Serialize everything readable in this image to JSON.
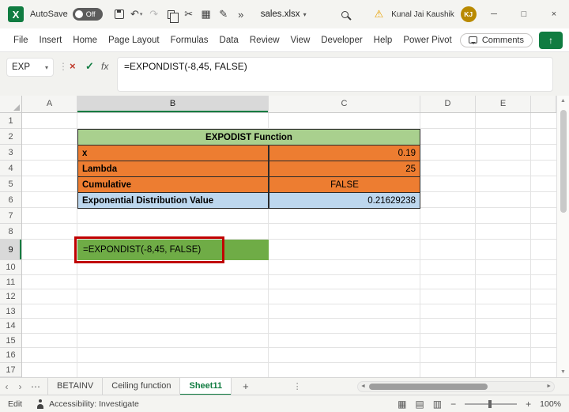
{
  "titlebar": {
    "app_logo": "X",
    "autosave_label": "AutoSave",
    "autosave_state": "Off",
    "more_commands": "»",
    "filename": "sales.xlsx",
    "user_name": "Kunal Jai Kaushik",
    "user_initials": "KJ"
  },
  "ribbon": {
    "tabs": [
      "File",
      "Insert",
      "Home",
      "Page Layout",
      "Formulas",
      "Data",
      "Review",
      "View",
      "Developer",
      "Help",
      "Power Pivot"
    ],
    "comments_label": "Comments"
  },
  "formula_bar": {
    "name_box_value": "EXP",
    "fx_label": "fx",
    "formula": "=EXPONDIST(-8,45, FALSE)"
  },
  "grid": {
    "column_labels": [
      "A",
      "B",
      "C",
      "D",
      "E"
    ],
    "row_labels": [
      "1",
      "2",
      "3",
      "4",
      "5",
      "6",
      "7",
      "8",
      "9",
      "10",
      "11",
      "12",
      "13",
      "14",
      "15",
      "16",
      "17"
    ],
    "selected_column": "B",
    "selected_row": "9"
  },
  "sheet": {
    "table": {
      "title": "EXPODIST Function",
      "rows": [
        {
          "label": "x",
          "value": "0.19"
        },
        {
          "label": "Lambda",
          "value": "25"
        },
        {
          "label": "Cumulative",
          "value": "FALSE"
        },
        {
          "label": "Exponential Distribution Value",
          "value": "0.21629238"
        }
      ]
    },
    "b9_formula": "=EXPONDIST(-8,45, FALSE)"
  },
  "sheet_tabs": {
    "tabs": [
      {
        "name": "BETAINV",
        "active": false
      },
      {
        "name": "Ceiling function",
        "active": false
      },
      {
        "name": "Sheet11",
        "active": true
      }
    ]
  },
  "status_bar": {
    "mode": "Edit",
    "accessibility": "Accessibility: Investigate",
    "zoom": "100%"
  },
  "colors": {
    "excel_green": "#107C41",
    "table_header_green": "#A9D08E",
    "orange": "#ED7D31",
    "light_blue": "#BDD7EE",
    "result_green": "#6FAC46",
    "highlight_red": "#C00000",
    "avatar_gold": "#B98A00",
    "warning_yellow": "#E8A000"
  }
}
